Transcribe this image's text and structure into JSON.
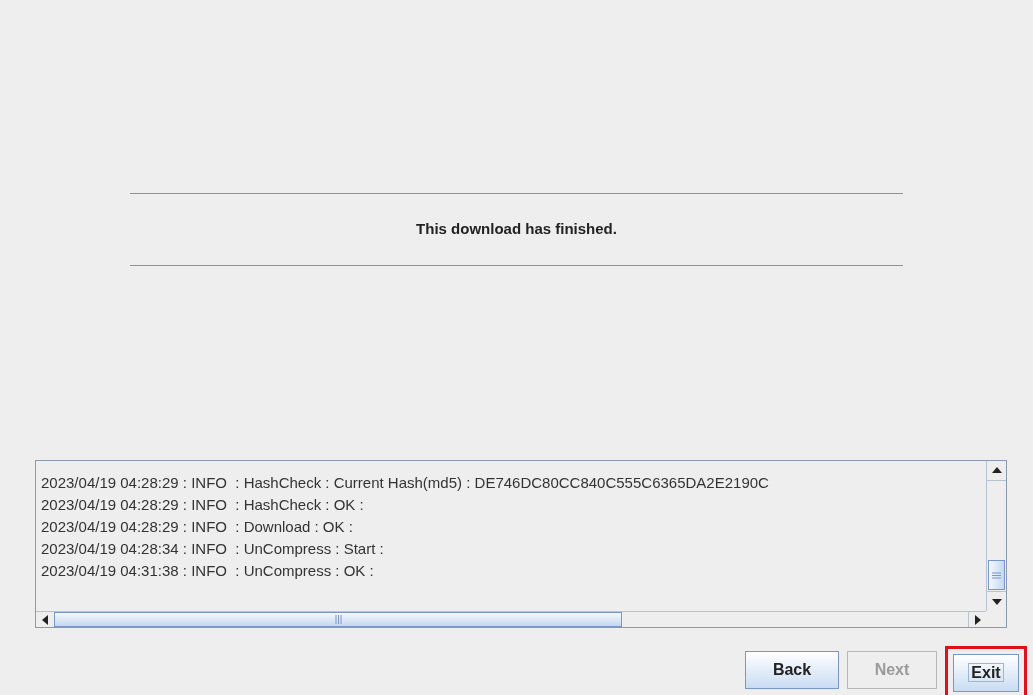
{
  "message": "This download has finished.",
  "log": {
    "lines": [
      "2023/04/19 04:28:29 : INFO  : HashCheck : Current Hash(md5) : DE746DC80CC840C555C6365DA2E2190C",
      "2023/04/19 04:28:29 : INFO  : HashCheck : OK :",
      "2023/04/19 04:28:29 : INFO  : Download : OK :",
      "2023/04/19 04:28:34 : INFO  : UnCompress : Start :",
      "2023/04/19 04:31:38 : INFO  : UnCompress : OK :"
    ]
  },
  "buttons": [
    {
      "label": "Back",
      "disabled": false,
      "focused": false,
      "highlighted": false
    },
    {
      "label": "Next",
      "disabled": true,
      "focused": false,
      "highlighted": false
    },
    {
      "label": "Exit",
      "disabled": false,
      "focused": true,
      "highlighted": true
    }
  ]
}
